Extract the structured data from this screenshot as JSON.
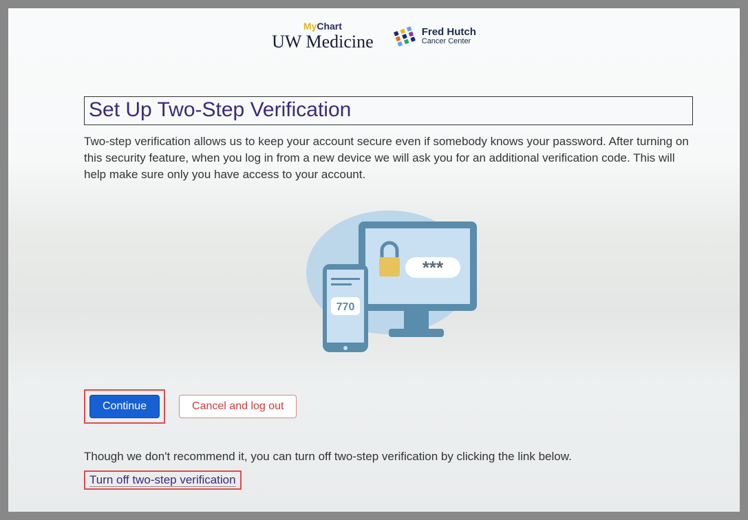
{
  "logos": {
    "mychart_prefix": "My",
    "mychart_suffix": "Chart",
    "uwmed": "UW Medicine",
    "fh_line1": "Fred Hutch",
    "fh_line2": "Cancer Center"
  },
  "page": {
    "title": "Set Up Two-Step Verification",
    "description": "Two-step verification allows us to keep your account secure even if somebody knows your password. After turning on this security feature, when you log in from a new device we will ask you for an additional verification code. This will help make sure only you have access to your account.",
    "illustration_code": "770"
  },
  "buttons": {
    "continue": "Continue",
    "cancel": "Cancel and log out"
  },
  "turnoff": {
    "note": "Though we don't recommend it, you can turn off two-step verification by clicking the link below.",
    "link": "Turn off two-step verification"
  }
}
